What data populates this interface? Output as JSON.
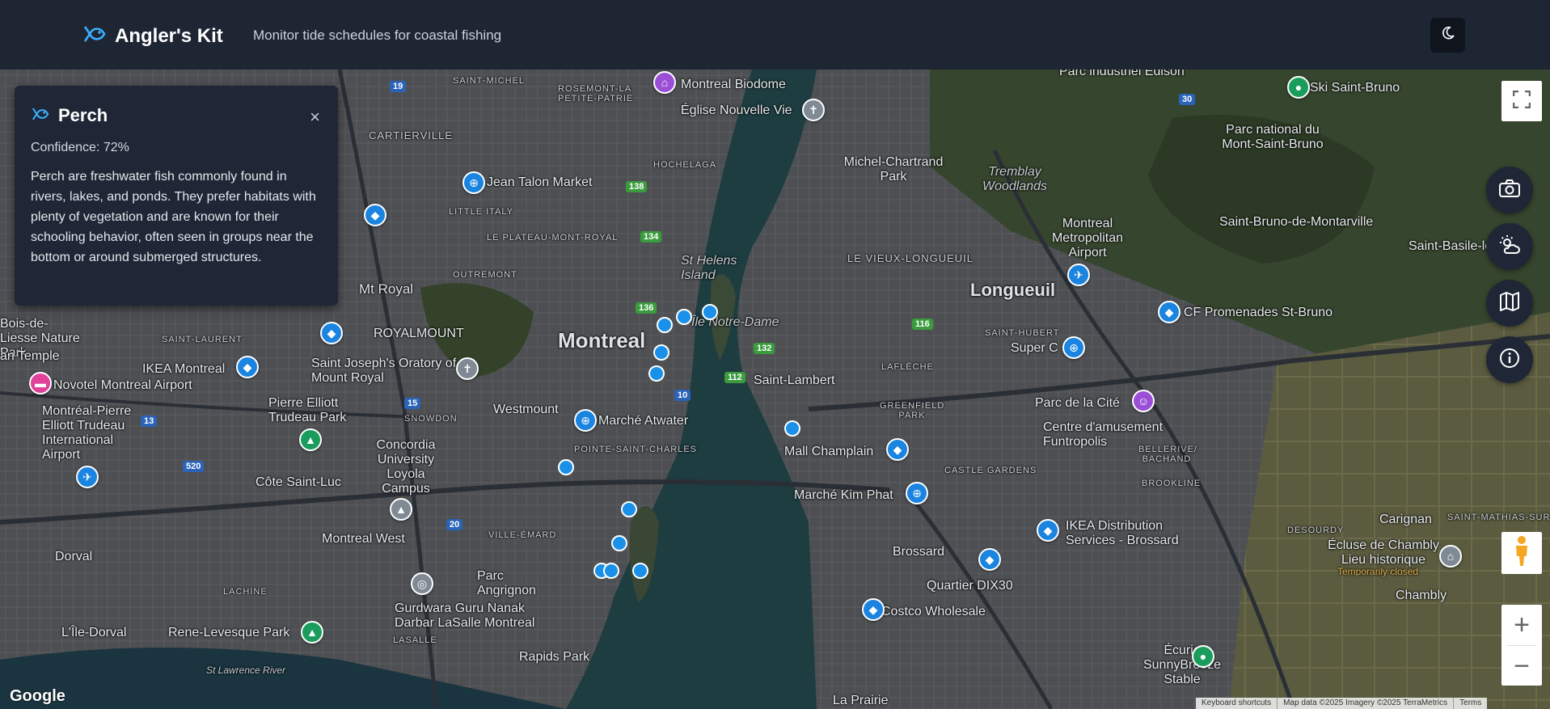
{
  "header": {
    "app_name": "Angler's Kit",
    "tagline": "Monitor tide schedules for coastal fishing",
    "logo_icon": "fish-icon",
    "theme_icon": "moon-icon"
  },
  "popup": {
    "title": "Perch",
    "confidence": "Confidence: 72%",
    "description": "Perch are freshwater fish commonly found in rivers, lakes, and ponds. They prefer habitats with plenty of vegetation and are known for their schooling behavior, often seen in groups near the bottom or around submerged structures.",
    "close_label": "×"
  },
  "map": {
    "labels": {
      "montreal": "Montreal",
      "longueuil": "Longueuil",
      "biodome": "Montreal Biodome",
      "eglise": "Église Nouvelle Vie",
      "jean_talon": "Jean Talon Market",
      "little_italy": "LITTLE ITALY",
      "plateau": "LE PLATEAU-MONT-ROYAL",
      "outremont": "OUTREMONT",
      "mt_royal": "Mt Royal",
      "royalmount": "ROYALMOUNT",
      "saint_laurent": "SAINT-LAURENT",
      "ikea_mtl": "IKEA Montreal",
      "oratory": "Saint Joseph's Oratory of Mount Royal",
      "novotel": "Novotel Montreal Airport",
      "airport": "Montréal-Pierre Elliott Trudeau International Airport",
      "pet_park": "Pierre Elliott Trudeau Park",
      "westmount": "Westmount",
      "marche_atwater": "Marché Atwater",
      "concordia": "Concordia University Loyola Campus",
      "cote_st_luc": "Côte Saint-Luc",
      "mtl_west": "Montreal West",
      "dorval": "Dorval",
      "ile_dorval": "L'Île-Dorval",
      "rene_levesque": "Rene-Levesque Park",
      "parc_angrignon": "Parc Angrignon",
      "gurdwara": "Gurdwara Guru Nanak Darbar LaSalle Montreal",
      "rapids_park": "Rapids Park",
      "st_lawrence": "St Lawrence River",
      "st_helens": "St Helens Island",
      "ile_nd": "Île Notre-Dame",
      "saint_lambert": "Saint-Lambert",
      "mall_champlain": "Mall Champlain",
      "marche_kim_phat": "Marché Kim Phat",
      "brossard": "Brossard",
      "quartier_dix30": "Quartier DIX30",
      "costco": "Costco Wholesale",
      "ikea_distrib": "IKEA Distribution Services - Brossard",
      "centre_amusement": "Centre d'amusement Funtropolis",
      "parc_cite": "Parc de la Cité",
      "super_c": "Super C",
      "cf_promenades": "CF Promenades St-Bruno",
      "metro_airport": "Montreal Metropolitan Airport",
      "vieux_longueuil": "LE VIEUX-LONGUEUIL",
      "michel_chartrand": "Michel-Chartrand Park",
      "tremblay": "Tremblay Woodlands",
      "st_bruno": "Saint-Bruno-de-Montarville",
      "parc_mont_st_bruno": "Parc national du Mont-Saint-Bruno",
      "ski_st_bruno": "Ski Saint-Bruno",
      "st_basile": "Saint-Basile-le-G",
      "carignan": "Carignan",
      "chambly": "Chambly",
      "ecluse": "Écluse de Chambly Lieu historique",
      "temp_closed": "Temporarily closed",
      "ecurie": "Écurie SunnyBreeze Stable",
      "cartierville": "CARTIERVILLE",
      "petite_patrie": "ROSEMONT-LA PETITE-PATRIE",
      "hochelaga": "HOCHELAGA",
      "greenfield": "GREENFIELD PARK",
      "laflèche": "LAFLÈCHE",
      "castle_gardens": "CASTLE GARDENS",
      "brookline": "BROOKLINE",
      "bellerive": "BELLERIVE/ BACHAND",
      "desourdy": "DESOURDY",
      "st_mathias": "SAINT-MATHIAS-SUR",
      "saint_hubert": "SAINT-HUBERT",
      "la_prairie": "La Prairie",
      "lachine": "LACHINE",
      "snowdon": "SNOWDON",
      "ville_emard": "VILLE-ÉMARD",
      "lasalle": "LASALLE",
      "pointe_st_charles": "POINTE-SAINT-CHARLES",
      "saint_michel": "SAINT-MICHEL",
      "parc_industriel": "Parc industriel Edison",
      "bois_de_liesse": "Bois-de-Liesse Nature Park",
      "ran_temple": "an Temple"
    },
    "routes": [
      "19",
      "138",
      "134",
      "136",
      "132",
      "112",
      "116",
      "30",
      "15",
      "20",
      "520",
      "13",
      "10"
    ]
  },
  "controls": {
    "fullscreen_icon": "fullscreen-icon",
    "camera_icon": "camera-icon",
    "weather_icon": "weather-icon",
    "map_icon": "map-layers-icon",
    "info_icon": "info-icon",
    "pegman_icon": "pegman-icon",
    "zoom_in": "+",
    "zoom_out": "−"
  },
  "footer": {
    "google": "Google",
    "shortcuts": "Keyboard shortcuts",
    "map_data": "Map data ©2025 Imagery ©2025 TerraMetrics",
    "terms": "Terms"
  },
  "colors": {
    "header_bg": "#1e2533",
    "accent": "#3ab0ff",
    "popup_bg": "#1f2736",
    "pin_blue": "#1a84e0",
    "pin_green": "#1a9d5c"
  }
}
